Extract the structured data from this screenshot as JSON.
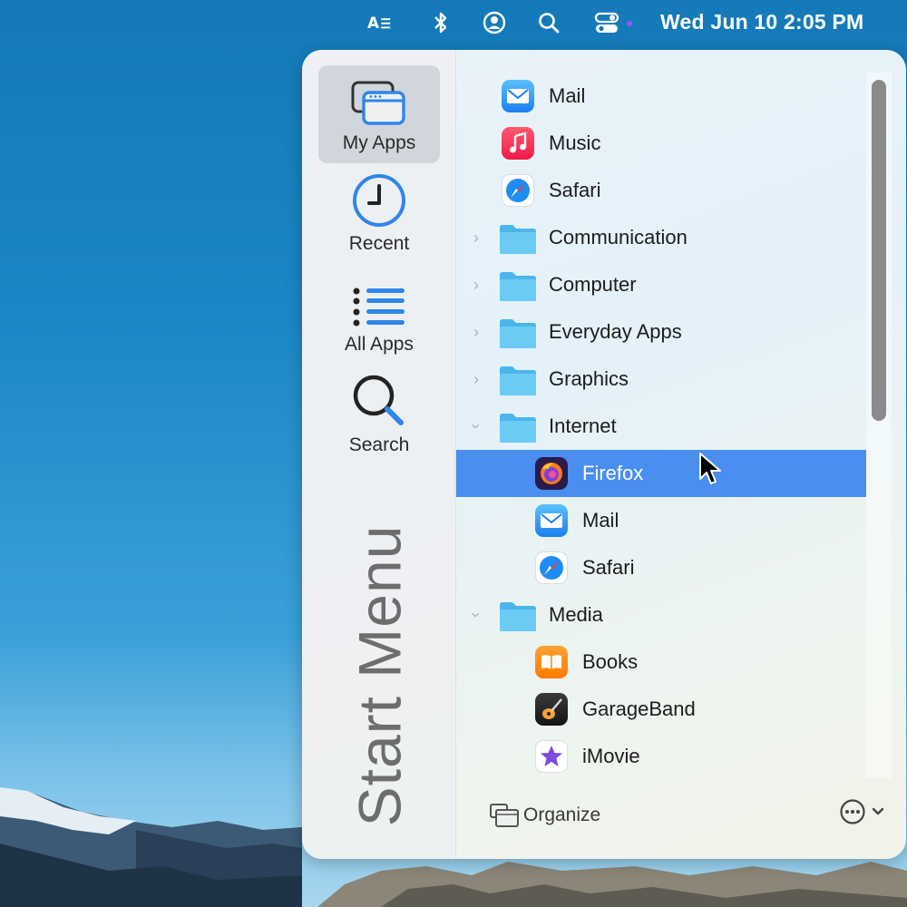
{
  "menubar": {
    "icons": [
      "text-input-icon",
      "bluetooth-icon",
      "user-icon",
      "search-icon",
      "control-center-icon"
    ],
    "datetime": "Wed Jun 10  2:05 PM"
  },
  "sidebar": {
    "items": [
      {
        "label": "My Apps",
        "icon": "my-apps-icon",
        "active": true
      },
      {
        "label": "Recent",
        "icon": "clock-icon",
        "active": false
      },
      {
        "label": "All Apps",
        "icon": "list-icon",
        "active": false
      },
      {
        "label": "Search",
        "icon": "search-icon",
        "active": false
      }
    ],
    "title": "Start Menu"
  },
  "list": {
    "items": [
      {
        "label": "Mail",
        "kind": "app",
        "icon": "mail-icon"
      },
      {
        "label": "Music",
        "kind": "app",
        "icon": "music-icon"
      },
      {
        "label": "Safari",
        "kind": "app",
        "icon": "safari-icon"
      },
      {
        "label": "Communication",
        "kind": "folder",
        "expanded": false
      },
      {
        "label": "Computer",
        "kind": "folder",
        "expanded": false
      },
      {
        "label": "Everyday Apps",
        "kind": "folder",
        "expanded": false
      },
      {
        "label": "Graphics",
        "kind": "folder",
        "expanded": false
      },
      {
        "label": "Internet",
        "kind": "folder",
        "expanded": true
      },
      {
        "label": "Firefox",
        "kind": "app",
        "icon": "firefox-icon",
        "selected": true
      },
      {
        "label": "Mail",
        "kind": "app",
        "icon": "mail-icon"
      },
      {
        "label": "Safari",
        "kind": "app",
        "icon": "safari-icon"
      },
      {
        "label": "Media",
        "kind": "folder",
        "expanded": true
      },
      {
        "label": "Books",
        "kind": "app",
        "icon": "books-icon"
      },
      {
        "label": "GarageBand",
        "kind": "app",
        "icon": "garageband-icon"
      },
      {
        "label": "iMovie",
        "kind": "app",
        "icon": "imovie-icon"
      }
    ]
  },
  "footer": {
    "organize_label": "Organize",
    "more_icon": "ellipsis-circle-icon"
  },
  "colors": {
    "selection": "#4a8ef0",
    "folder": "#5cc1f0"
  }
}
